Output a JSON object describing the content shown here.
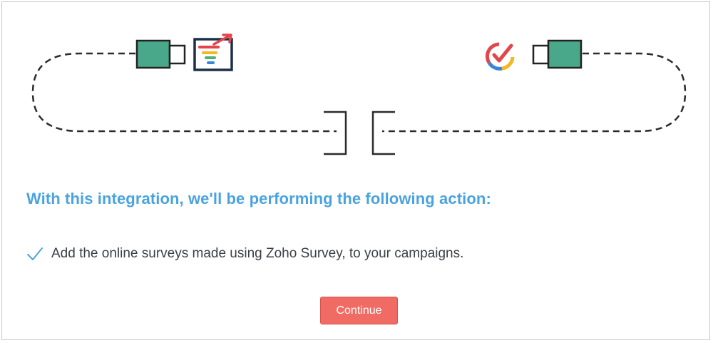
{
  "integration": {
    "source_app_icon": "zoho-survey-funnel-icon",
    "target_app_icon": "zoho-campaigns-check-icon",
    "connector_icon": "plug-connector-icon"
  },
  "headline": "With this integration, we'll be performing the following action:",
  "actions": [
    {
      "icon": "checkmark-icon",
      "text": "Add the online surveys made using Zoho Survey, to your campaigns."
    }
  ],
  "continue_label": "Continue",
  "colors": {
    "headline": "#4aa3df",
    "plug": "#4aa88a",
    "button": "#ef6b64",
    "text": "#3a3f45"
  }
}
